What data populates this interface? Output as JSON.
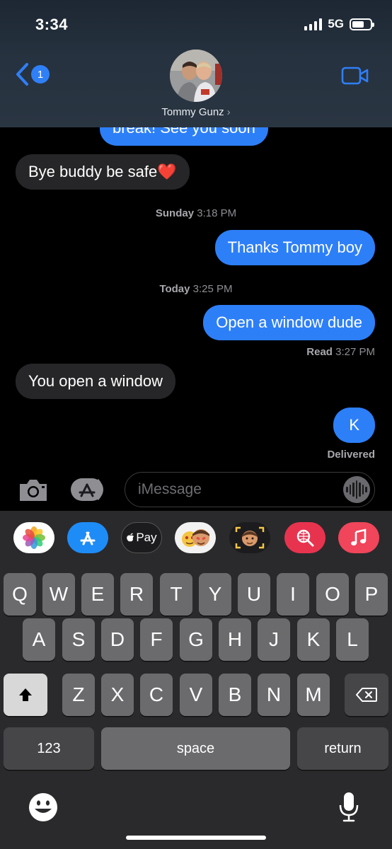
{
  "status_bar": {
    "time": "3:34",
    "network": "5G",
    "battery_level": 0.65
  },
  "header": {
    "back_badge": "1",
    "contact_name": "Tommy Gunz",
    "contact_chevron": "›"
  },
  "conversation": {
    "partial_top": {
      "text": "break! See you soon",
      "direction": "outgoing"
    },
    "m1": {
      "text": "Bye buddy be safe",
      "emoji": "❤️",
      "direction": "incoming"
    },
    "ts1": {
      "day": "Sunday",
      "time": "3:18 PM"
    },
    "m2": {
      "text": "Thanks Tommy boy",
      "direction": "outgoing"
    },
    "ts2": {
      "day": "Today",
      "time": "3:25 PM"
    },
    "m3": {
      "text": "Open a window dude",
      "direction": "outgoing"
    },
    "read": {
      "label": "Read",
      "time": "3:27 PM"
    },
    "m4": {
      "text": "You open a window",
      "direction": "incoming"
    },
    "m5": {
      "text": "K",
      "direction": "outgoing"
    },
    "delivered": "Delivered"
  },
  "input": {
    "placeholder": "iMessage",
    "value": ""
  },
  "app_strip": {
    "items": [
      "photos-icon",
      "app-store-icon",
      "apple-pay-icon",
      "memoji-stickers-icon",
      "memoji-icon",
      "image-search-icon",
      "music-icon"
    ],
    "apple_pay_label": "Pay"
  },
  "keyboard": {
    "row1": [
      "Q",
      "W",
      "E",
      "R",
      "T",
      "Y",
      "U",
      "I",
      "O",
      "P"
    ],
    "row2": [
      "A",
      "S",
      "D",
      "F",
      "G",
      "H",
      "J",
      "K",
      "L"
    ],
    "row3": [
      "Z",
      "X",
      "C",
      "V",
      "B",
      "N",
      "M"
    ],
    "numbers": "123",
    "space": "space",
    "return": "return"
  },
  "colors": {
    "outgoing_bubble": "#2d7ff8",
    "incoming_bubble": "#262628",
    "keyboard_bg": "#2a2a2c",
    "key": "#6b6b6e",
    "accent": "#2f7ff7"
  }
}
